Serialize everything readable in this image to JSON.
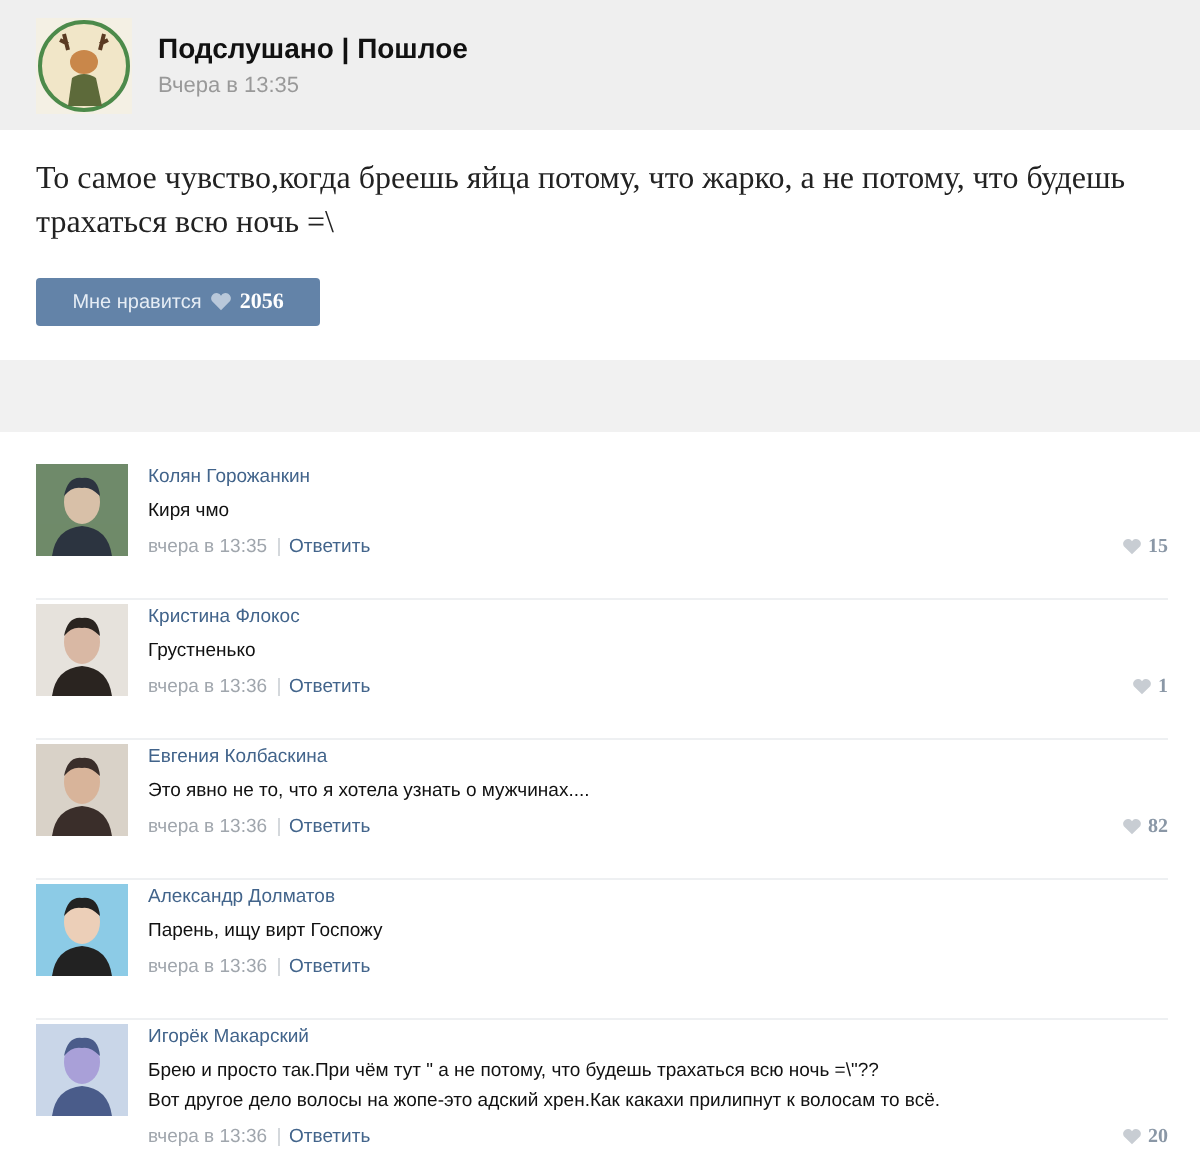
{
  "post": {
    "group_name": "Подслушано | Пошлое",
    "time": "Вчера в 13:35",
    "text": "То самое чувство,когда бреешь яйца потому, что жарко, а не потому, что будешь трахаться всю ночь =\\",
    "like_label": "Мне нравится",
    "like_count": "2056"
  },
  "comments": [
    {
      "author": "Колян Горожанкин",
      "lines": [
        "Киря чмо"
      ],
      "time": "вчера в 13:35",
      "reply": "Ответить",
      "likes": "15"
    },
    {
      "author": "Кристина Флокос",
      "lines": [
        "Грустненько"
      ],
      "time": "вчера в 13:36",
      "reply": "Ответить",
      "likes": "1"
    },
    {
      "author": "Евгения Колбаскина",
      "lines": [
        "Это явно не то, что я хотела узнать о мужчинах...."
      ],
      "time": "вчера в 13:36",
      "reply": "Ответить",
      "likes": "82"
    },
    {
      "author": "Александр Долматов",
      "lines": [
        "Парень, ищу вирт Госпожу"
      ],
      "time": "вчера в 13:36",
      "reply": "Ответить"
    },
    {
      "author": "Игорёк Макарский",
      "lines": [
        "Брею и просто так.При чём тут \" а не потому, что будешь трахаться всю ночь =\\\"??",
        "Вот другое дело волосы на жопе-это адский хрен.Как какахи прилипнут к волосам то всё."
      ],
      "time": "вчера в 13:36",
      "reply": "Ответить",
      "likes": "20"
    }
  ]
}
